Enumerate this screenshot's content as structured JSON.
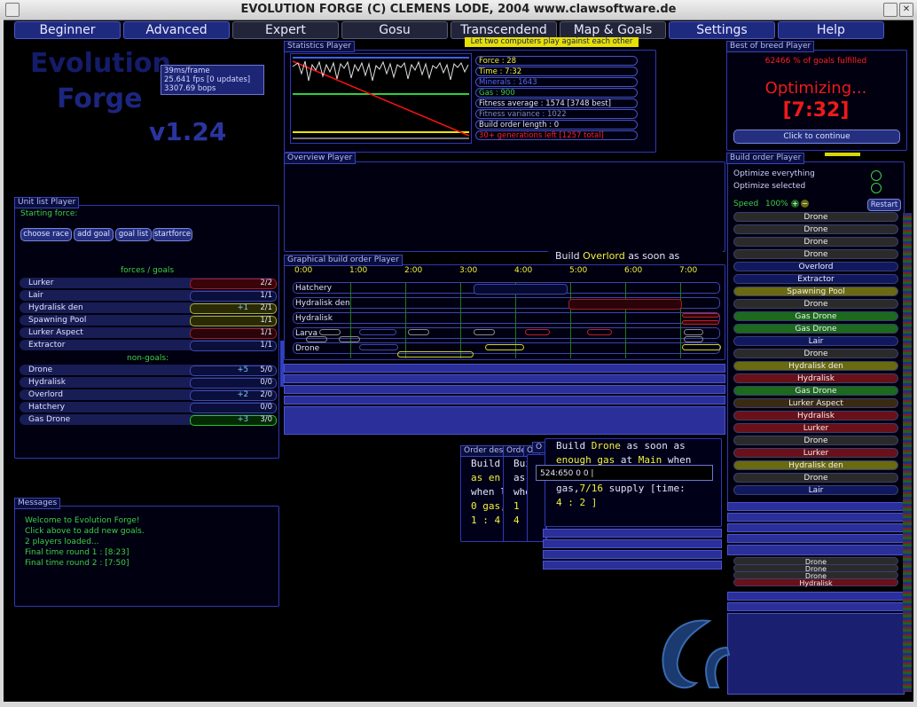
{
  "window": {
    "title": "EVOLUTION FORGE (C) CLEMENS LODE, 2004 www.clawsoftware.de"
  },
  "tabs": [
    "Beginner",
    "Advanced",
    "Expert",
    "Gosu",
    "Transcendend",
    "Map & Goals",
    "Settings",
    "Help"
  ],
  "tooltip": "Let two computers play against each other",
  "logo": {
    "line1": "Evolution",
    "line2": "Forge",
    "version": "v1.24"
  },
  "perf": {
    "ms": "39ms/frame",
    "fps": "25.641 fps [0 updates]",
    "bops": "3307.69 bops"
  },
  "stats": {
    "title": "Statistics Player",
    "rows": [
      "Force : 28",
      "Time : 7:32",
      "Minerals : 1643",
      "Gas : 900",
      "Fitness average : 1574 [3748 best]",
      "Fitness variance : 1022",
      "Build order length : 0",
      "30+ generations left [1257 total]"
    ]
  },
  "best": {
    "title": "Best of breed Player",
    "goals": "62466 % of goals fulfilled",
    "status": "Optimizing...",
    "time": "[7:32]",
    "continue": "Click to continue"
  },
  "overview": {
    "title": "Overview Player"
  },
  "unitlist": {
    "title": "Unit list Player",
    "starting_force": "Starting force:",
    "buttons": [
      "choose race",
      "add goal",
      "goal list",
      "startforce"
    ],
    "forces_header": "forces / goals",
    "forces": [
      {
        "name": "Lurker",
        "val": "2/2",
        "plus": ""
      },
      {
        "name": "Lair",
        "val": "1/1",
        "plus": ""
      },
      {
        "name": "Hydralisk den",
        "val": "2/1",
        "plus": "+1"
      },
      {
        "name": "Spawning Pool",
        "val": "1/1",
        "plus": ""
      },
      {
        "name": "Lurker Aspect",
        "val": "1/1",
        "plus": ""
      },
      {
        "name": "Extractor",
        "val": "1/1",
        "plus": ""
      }
    ],
    "nongoals_header": "non-goals:",
    "nongoals": [
      {
        "name": "Drone",
        "val": "5/0",
        "plus": "+5"
      },
      {
        "name": "Hydralisk",
        "val": "0/0",
        "plus": ""
      },
      {
        "name": "Overlord",
        "val": "2/0",
        "plus": "+2"
      },
      {
        "name": "Hatchery",
        "val": "0/0",
        "plus": ""
      },
      {
        "name": "Gas Drone",
        "val": "3/0",
        "plus": "+3"
      }
    ]
  },
  "graph": {
    "title": "Graphical build order Player",
    "ticks": [
      "0:00",
      "1:00",
      "2:00",
      "3:00",
      "4:00",
      "5:00",
      "6:00",
      "7:00"
    ],
    "rows": [
      "Hatchery",
      "Hydralisk den",
      "Hydralisk",
      "Larva",
      "Drone"
    ],
    "build_overlord": {
      "pre": "Build",
      "unit": "Overlord",
      "post": "as soon as"
    }
  },
  "buildorder": {
    "title": "Build order Player",
    "opt_everything": "Optimize everything",
    "opt_selected": "Optimize selected",
    "speed": "Speed",
    "speed_val": "100%",
    "restart": "Restart",
    "items": [
      {
        "name": "Drone",
        "color": "#2a2a2a"
      },
      {
        "name": "Drone",
        "color": "#2a2a2a"
      },
      {
        "name": "Drone",
        "color": "#2a2a2a"
      },
      {
        "name": "Drone",
        "color": "#2a2a2a"
      },
      {
        "name": "Overlord",
        "color": "#101860"
      },
      {
        "name": "Extractor",
        "color": "#101860"
      },
      {
        "name": "Spawning Pool",
        "color": "#6a6a10"
      },
      {
        "name": "Drone",
        "color": "#2a2a2a"
      },
      {
        "name": "Gas Drone",
        "color": "#1c6a1c"
      },
      {
        "name": "Gas Drone",
        "color": "#1c6a1c"
      },
      {
        "name": "Lair",
        "color": "#101860"
      },
      {
        "name": "Drone",
        "color": "#2a2a2a"
      },
      {
        "name": "Hydralisk den",
        "color": "#6a6a10"
      },
      {
        "name": "Hydralisk",
        "color": "#6a1018"
      },
      {
        "name": "Gas Drone",
        "color": "#1c6a1c"
      },
      {
        "name": "Lurker Aspect",
        "color": "#3a2a10"
      },
      {
        "name": "Hydralisk",
        "color": "#6a1018"
      },
      {
        "name": "Lurker",
        "color": "#6a1018"
      },
      {
        "name": "Drone",
        "color": "#2a2a2a"
      },
      {
        "name": "Lurker",
        "color": "#6a1018"
      },
      {
        "name": "Hydralisk den",
        "color": "#6a6a10"
      },
      {
        "name": "Drone",
        "color": "#2a2a2a"
      },
      {
        "name": "Lair",
        "color": "#101860"
      }
    ],
    "tail": [
      "Drone",
      "Drone",
      "Drone",
      "Hydralisk"
    ]
  },
  "orders": {
    "titles": [
      "Order des",
      "Orde",
      "Or",
      "O"
    ],
    "short": [
      "Build S",
      "as en",
      "when l",
      "0 gas,",
      "1 : 4"
    ],
    "short2": [
      "Build",
      "as",
      "when",
      "1",
      "4"
    ],
    "main": {
      "l1_pre": "Build",
      "l1_unit": "Drone",
      "l1_post": "as soon as",
      "l2_pre": "enough gas",
      "l2_mid": "at",
      "l2_loc": "Main",
      "l2_post": "when",
      "input": "524:650 0 0 |",
      "l3_pre": "gas,",
      "l3_sup": "7/16",
      "l3_post": "supply [time:",
      "l4": "4 : 2 ]"
    }
  },
  "messages": {
    "title": "Messages",
    "lines": [
      "Welcome to Evolution Forge!",
      "Click above to add new goals.",
      "2 players loaded...",
      "Final time round 1 : [8:23]",
      "Final time round 2 : [7:50]"
    ]
  }
}
